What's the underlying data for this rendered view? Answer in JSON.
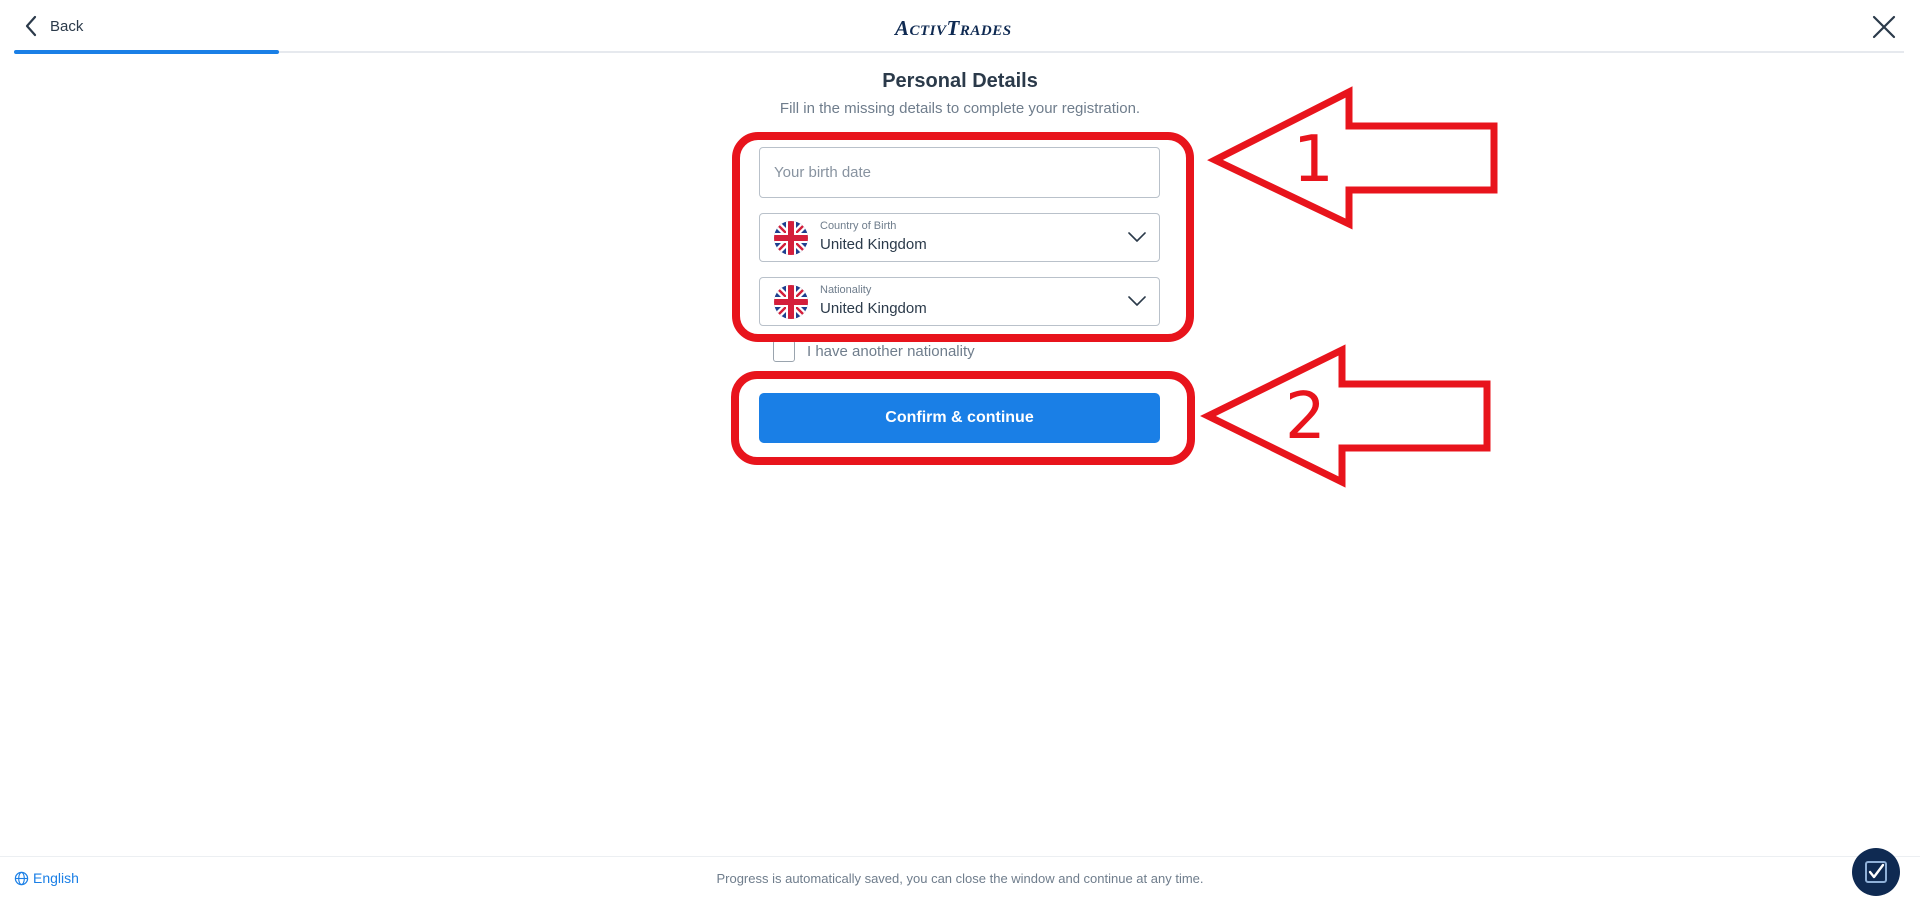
{
  "header": {
    "back_label": "Back",
    "logo_text": "ActivTrades",
    "progress_fraction": 0.14
  },
  "main": {
    "title": "Personal Details",
    "subtitle": "Fill in the missing details to complete your registration.",
    "birth_date": {
      "placeholder": "Your birth date",
      "value": ""
    },
    "country_of_birth": {
      "label": "Country of Birth",
      "value": "United Kingdom"
    },
    "nationality": {
      "label": "Nationality",
      "value": "United Kingdom"
    },
    "another_nationality": {
      "label": "I have another nationality",
      "checked": false
    },
    "confirm_label": "Confirm & continue"
  },
  "annotations": {
    "color": "#e8141c",
    "marker_1": "1",
    "marker_2": "2"
  },
  "footer": {
    "language": "English",
    "note": "Progress is automatically saved, you can close the window and continue at any time."
  },
  "colors": {
    "primary": "#1a7fe6",
    "brand_navy": "#0f2a52"
  },
  "icons": [
    "chevron-left-icon",
    "close-icon",
    "uk-flag-icon",
    "chevron-down-icon",
    "globe-icon",
    "help-widget-icon"
  ]
}
